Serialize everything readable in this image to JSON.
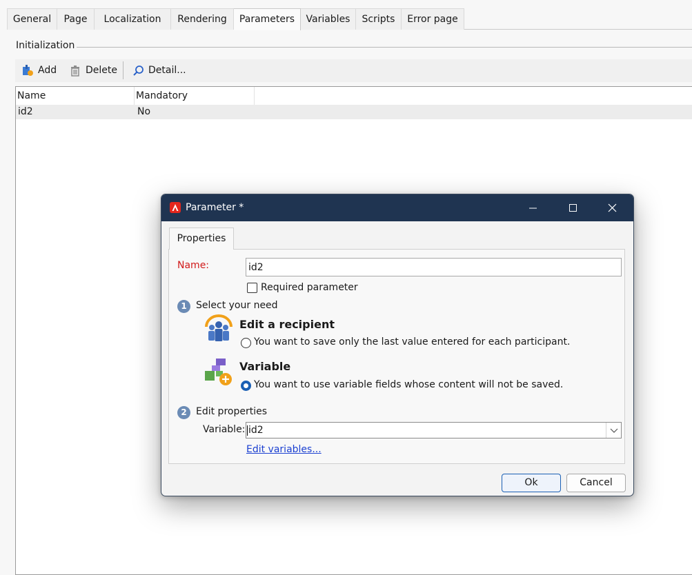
{
  "tabs": [
    "General",
    "Page",
    "Localization",
    "Rendering",
    "Parameters",
    "Variables",
    "Scripts",
    "Error page"
  ],
  "active_tab": "Parameters",
  "section": {
    "title": "Initialization"
  },
  "toolbar": {
    "add": "Add",
    "delete": "Delete",
    "detail": "Detail..."
  },
  "grid": {
    "columns": [
      "Name",
      "Mandatory"
    ],
    "rows": [
      {
        "name": "id2",
        "mandatory": "No"
      }
    ]
  },
  "dialog": {
    "title": "Parameter *",
    "tab": "Properties",
    "name_label": "Name:",
    "name_value": "id2",
    "required_label": "Required parameter",
    "required_checked": false,
    "step1": {
      "num": "1",
      "label": "Select your need"
    },
    "option_recipient": {
      "title": "Edit a recipient",
      "desc": "You want to save only the last value entered for each participant.",
      "selected": false
    },
    "option_variable": {
      "title": "Variable",
      "desc": "You want to use variable fields whose content will not be saved.",
      "selected": true
    },
    "step2": {
      "num": "2",
      "label": "Edit properties"
    },
    "variable_label": "Variable:",
    "variable_value": "id2",
    "edit_variables_link": "Edit variables...",
    "ok_label": "Ok",
    "cancel_label": "Cancel"
  },
  "colors": {
    "titlebar": "#1f3451",
    "required_label": "#d11a1a",
    "link": "#1a3fd1",
    "step_badge": "#6b8bb5",
    "radio_selected": "#1a5fb4"
  }
}
